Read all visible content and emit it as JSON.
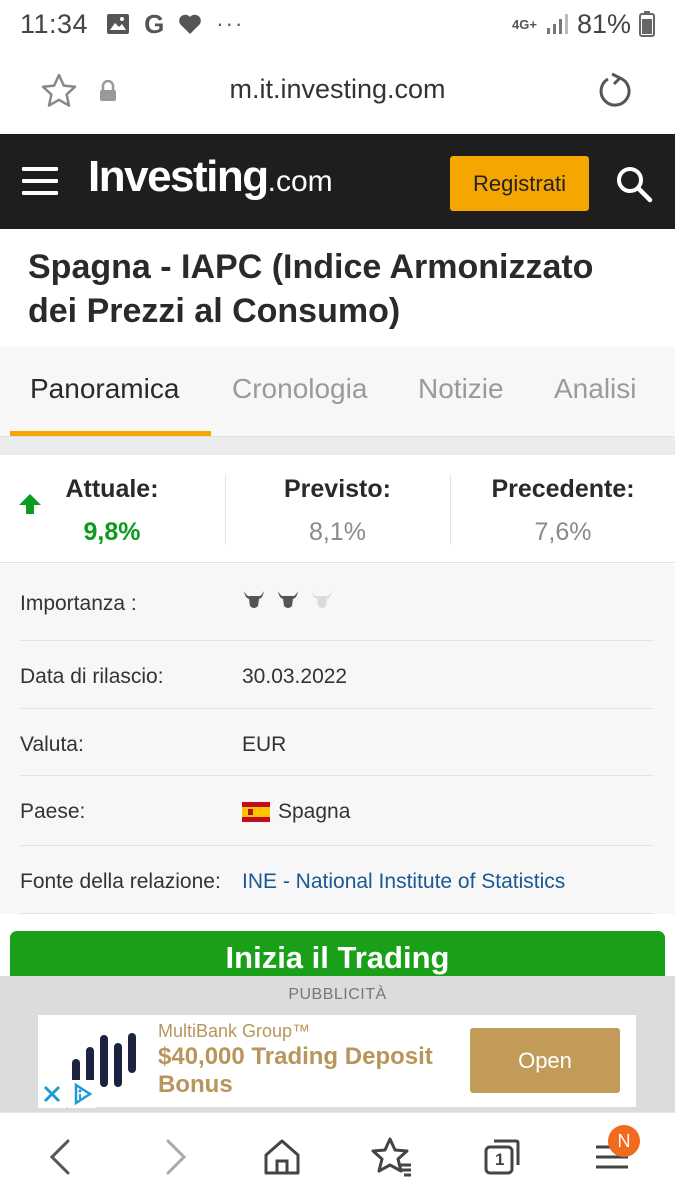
{
  "status_bar": {
    "time": "11:34",
    "google_glyph": "G",
    "more_glyph": "···",
    "network": "4G+",
    "battery": "81%"
  },
  "browser": {
    "url": "m.it.investing.com",
    "icons": [
      "star-icon",
      "lock-icon",
      "reload-icon"
    ]
  },
  "header": {
    "logo_main": "Investing",
    "logo_suffix": ".com",
    "register_label": "Registrati",
    "icons": [
      "hamburger-icon",
      "search-icon"
    ]
  },
  "page": {
    "title": "Spagna - IAPC (Indice Armonizzato dei Prezzi al Consumo)"
  },
  "tabs": [
    {
      "label": "Panoramica",
      "active": true
    },
    {
      "label": "Cronologia",
      "active": false
    },
    {
      "label": "Notizie",
      "active": false
    },
    {
      "label": "Analisi",
      "active": false
    }
  ],
  "values": {
    "current_label": "Attuale:",
    "current_value": "9,8%",
    "forecast_label": "Previsto:",
    "forecast_value": "8,1%",
    "previous_label": "Precedente:",
    "previous_value": "7,6%",
    "trend": "up",
    "up_color": "#0b9b1d"
  },
  "details": {
    "importance_label": "Importanza :",
    "importance_level": 2,
    "importance_max": 3,
    "release_label": "Data di rilascio:",
    "release_value": "30.03.2022",
    "currency_label": "Valuta:",
    "currency_value": "EUR",
    "country_label": "Paese:",
    "country_value": "Spagna",
    "source_label": "Fonte della relazione:",
    "source_value": "INE - National Institute of Statistics"
  },
  "trade_button_label": "Inizia il Trading",
  "ad": {
    "label": "PUBBLICITÀ",
    "brand": "MultiBank Group™",
    "headline": "$40,000 Trading Deposit Bonus",
    "cta": "Open"
  },
  "bottom_nav": {
    "tabs_count": "1",
    "badge": "N",
    "icons": [
      "back-icon",
      "forward-icon",
      "home-icon",
      "bookmarks-icon",
      "tabs-icon",
      "menu-icon"
    ]
  },
  "colors": {
    "header_bg": "#1e1e1e",
    "accent": "#f5a600",
    "trade_green": "#19a018",
    "link": "#1a5896"
  }
}
